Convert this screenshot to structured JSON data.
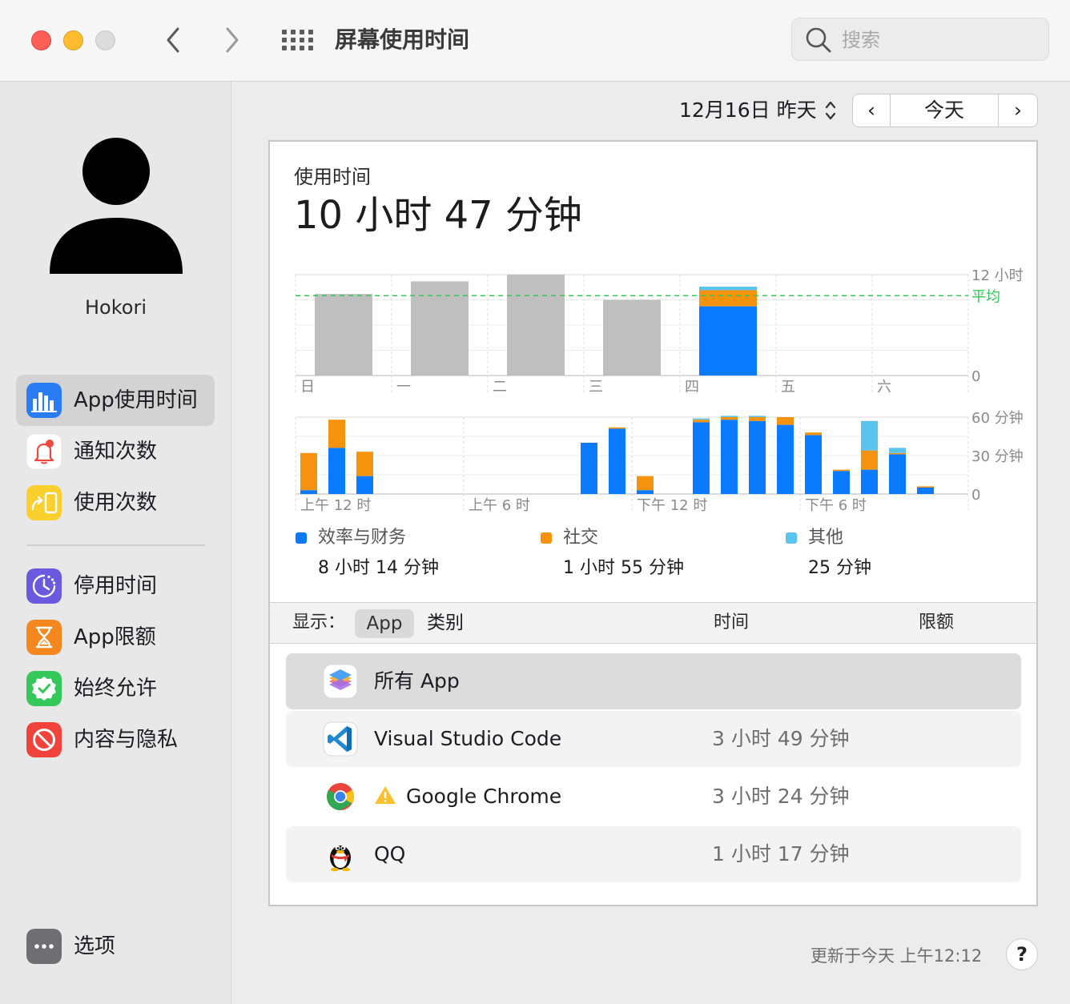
{
  "window": {
    "title": "屏幕使用时间"
  },
  "search": {
    "placeholder": "搜索"
  },
  "colors": {
    "productivity": "#0a7aff",
    "social": "#f5930e",
    "other": "#5ac3f0",
    "past_days": "#bfbfbf",
    "average_line": "#34c759"
  },
  "sidebar": {
    "user_name": "Hokori",
    "items": [
      {
        "label": "App使用时间",
        "icon": "bar-chart-icon",
        "selected": true
      },
      {
        "label": "通知次数",
        "icon": "bell-icon"
      },
      {
        "label": "使用次数",
        "icon": "pickup-icon"
      },
      {
        "label": "停用时间",
        "icon": "downtime-icon"
      },
      {
        "label": "App限额",
        "icon": "hourglass-icon"
      },
      {
        "label": "始终允许",
        "icon": "checkmark-badge-icon"
      },
      {
        "label": "内容与隐私",
        "icon": "no-entry-icon"
      }
    ],
    "options_label": "选项"
  },
  "date_nav": {
    "date_label": "12月16日 昨天",
    "today_label": "今天",
    "prev_symbol": "‹",
    "next_symbol": "›"
  },
  "usage": {
    "label": "使用时间",
    "total": "10 小时 47 分钟"
  },
  "chart_data": [
    {
      "type": "bar",
      "categories": [
        "日",
        "一",
        "二",
        "三",
        "四",
        "五",
        "六"
      ],
      "unit": "hours",
      "ylim": [
        0,
        12
      ],
      "y_ticks": [
        {
          "value": 12,
          "label": "12 小时"
        },
        {
          "value": 0,
          "label": "0"
        }
      ],
      "average": {
        "value": 9.5,
        "label": "平均"
      },
      "series": [
        {
          "name": "效率与财务",
          "color": "#0a7aff",
          "values": [
            0,
            0,
            0,
            0,
            8.23,
            0,
            0
          ]
        },
        {
          "name": "社交",
          "color": "#f5930e",
          "values": [
            0,
            0,
            0,
            0,
            1.92,
            0,
            0
          ]
        },
        {
          "name": "其他",
          "color": "#5ac3f0",
          "values": [
            0,
            0,
            0,
            0,
            0.42,
            0,
            0
          ]
        }
      ],
      "past_totals": [
        9.7,
        11.2,
        12.0,
        9.0,
        null,
        0,
        0
      ]
    },
    {
      "type": "bar",
      "x_unit": "hour",
      "x_ticks": [
        {
          "hour": 0,
          "label": "上午 12 时"
        },
        {
          "hour": 6,
          "label": "上午 6 时"
        },
        {
          "hour": 12,
          "label": "下午 12 时"
        },
        {
          "hour": 18,
          "label": "下午 6 时"
        }
      ],
      "unit": "minutes",
      "ylim": [
        0,
        60
      ],
      "y_ticks": [
        {
          "value": 60,
          "label": "60 分钟"
        },
        {
          "value": 30,
          "label": "30 分钟"
        },
        {
          "value": 0,
          "label": "0"
        }
      ],
      "hours": [
        0,
        1,
        2,
        10,
        11,
        12,
        14,
        15,
        16,
        17,
        18,
        19,
        20,
        21,
        22
      ],
      "series": [
        {
          "name": "效率与财务",
          "color": "#0a7aff",
          "values": [
            3,
            36,
            14,
            40,
            51,
            3,
            56,
            58,
            57,
            54,
            46,
            18,
            19,
            31,
            5
          ]
        },
        {
          "name": "社交",
          "color": "#f5930e",
          "values": [
            29,
            22,
            19,
            0,
            1,
            11,
            2,
            2,
            3,
            6,
            2,
            1,
            15,
            1,
            1
          ]
        },
        {
          "name": "其他",
          "color": "#5ac3f0",
          "values": [
            0,
            0,
            0,
            0,
            0,
            0,
            1,
            1,
            1,
            0,
            0,
            0,
            23,
            4,
            0
          ]
        }
      ]
    }
  ],
  "legend": [
    {
      "name": "效率与财务",
      "value": "8 小时 14 分钟",
      "color": "#0a7aff"
    },
    {
      "name": "社交",
      "value": "1 小时 55 分钟",
      "color": "#f5930e"
    },
    {
      "name": "其他",
      "value": "25 分钟",
      "color": "#5ac3f0"
    }
  ],
  "table": {
    "show_label": "显示：",
    "show_app": "App",
    "show_category": "类别",
    "col_time": "时间",
    "col_limit": "限额",
    "rows": [
      {
        "name": "所有 App",
        "time": "",
        "icon": "all-apps-icon"
      },
      {
        "name": "Visual Studio Code",
        "time": "3 小时 49 分钟",
        "icon": "vscode-icon"
      },
      {
        "name": "Google Chrome",
        "time": "3 小时 24 分钟",
        "icon": "chrome-icon",
        "warning": true
      },
      {
        "name": "QQ",
        "time": "1 小时 17 分钟",
        "icon": "qq-icon"
      }
    ]
  },
  "footer": {
    "updated": "更新于今天 上午12:12",
    "help": "?"
  }
}
